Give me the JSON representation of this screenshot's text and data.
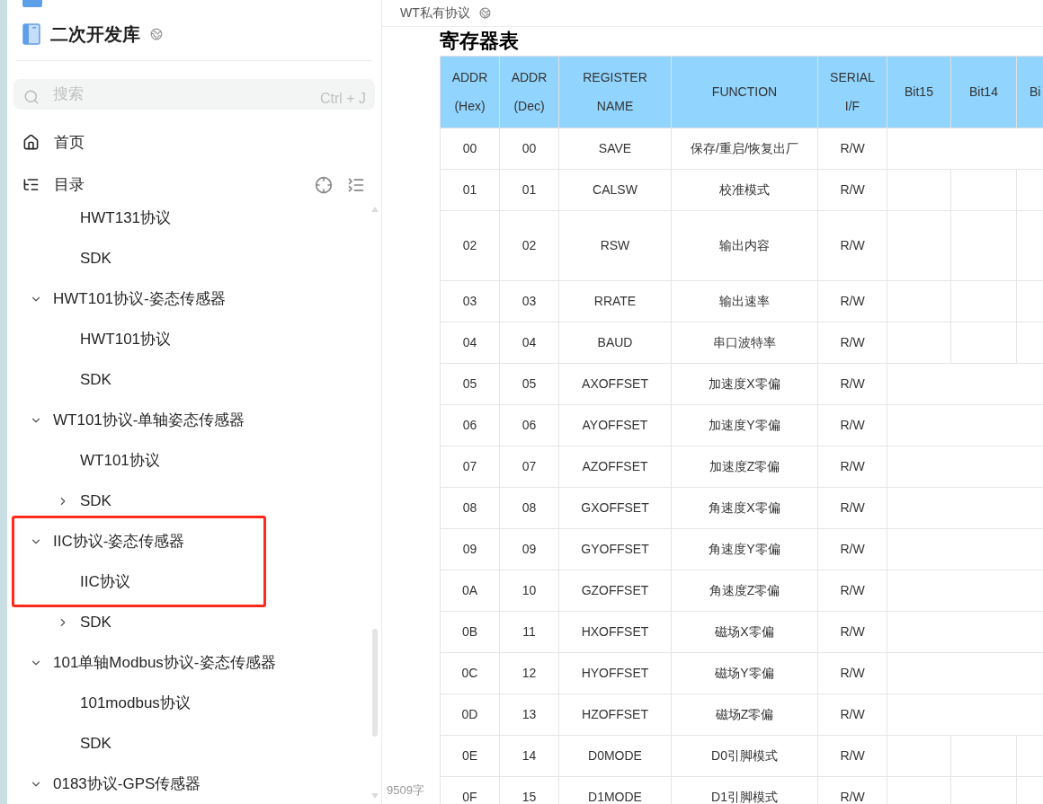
{
  "sidebar": {
    "title": "二次开发库",
    "search": {
      "placeholder": "搜索",
      "shortcut": "Ctrl + J"
    },
    "nav": [
      {
        "kind": "home",
        "label": "首页"
      },
      {
        "kind": "toc",
        "label": "目录"
      }
    ],
    "tree": [
      {
        "children": [
          {
            "label": "HWT131协议"
          },
          {
            "label": "SDK"
          }
        ]
      },
      {
        "label": "HWT101协议-姿态传感器",
        "expanded": true,
        "children": [
          {
            "label": "HWT101协议"
          },
          {
            "label": "SDK"
          }
        ]
      },
      {
        "label": "WT101协议-单轴姿态传感器",
        "expanded": true,
        "children": [
          {
            "label": "WT101协议"
          },
          {
            "label": "SDK",
            "expanded": false
          }
        ]
      },
      {
        "label": "IIC协议-姿态传感器",
        "expanded": true,
        "highlighted": true,
        "children": [
          {
            "label": "IIC协议",
            "highlighted": true
          },
          {
            "label": "SDK",
            "expanded": false
          }
        ]
      },
      {
        "label": "101单轴Modbus协议-姿态传感器",
        "expanded": true,
        "children": [
          {
            "label": "101modbus协议"
          },
          {
            "label": "SDK"
          }
        ]
      },
      {
        "label": "0183协议-GPS传感器",
        "expanded": true
      }
    ]
  },
  "main": {
    "breadcrumb": "WT私有协议",
    "heading": "寄存器表",
    "word_count": "9509字",
    "table": {
      "columns": [
        "ADDR (Hex)",
        "ADDR (Dec)",
        "REGISTER NAME",
        "FUNCTION",
        "SERIAL I/F",
        "Bit15",
        "Bit14",
        "Bi"
      ],
      "rows": [
        {
          "kind": "merged",
          "cells": [
            "00",
            "00",
            "SAVE",
            "保存/重启/恢复出厂",
            "R/W"
          ]
        },
        {
          "kind": "split",
          "cells": [
            "01",
            "01",
            "CALSW",
            "校准模式",
            "R/W"
          ]
        },
        {
          "kind": "split_tall",
          "cells": [
            "02",
            "02",
            "RSW",
            "输出内容",
            "R/W"
          ]
        },
        {
          "kind": "split",
          "cells": [
            "03",
            "03",
            "RRATE",
            "输出速率",
            "R/W"
          ]
        },
        {
          "kind": "split",
          "cells": [
            "04",
            "04",
            "BAUD",
            "串口波特率",
            "R/W"
          ]
        },
        {
          "kind": "merged",
          "cells": [
            "05",
            "05",
            "AXOFFSET",
            "加速度X零偏",
            "R/W"
          ]
        },
        {
          "kind": "merged",
          "cells": [
            "06",
            "06",
            "AYOFFSET",
            "加速度Y零偏",
            "R/W"
          ]
        },
        {
          "kind": "merged",
          "cells": [
            "07",
            "07",
            "AZOFFSET",
            "加速度Z零偏",
            "R/W"
          ]
        },
        {
          "kind": "merged",
          "cells": [
            "08",
            "08",
            "GXOFFSET",
            "角速度X零偏",
            "R/W"
          ]
        },
        {
          "kind": "merged",
          "cells": [
            "09",
            "09",
            "GYOFFSET",
            "角速度Y零偏",
            "R/W"
          ]
        },
        {
          "kind": "merged",
          "cells": [
            "0A",
            "10",
            "GZOFFSET",
            "角速度Z零偏",
            "R/W"
          ]
        },
        {
          "kind": "merged",
          "cells": [
            "0B",
            "11",
            "HXOFFSET",
            "磁场X零偏",
            "R/W"
          ]
        },
        {
          "kind": "merged",
          "cells": [
            "0C",
            "12",
            "HYOFFSET",
            "磁场Y零偏",
            "R/W"
          ]
        },
        {
          "kind": "merged",
          "cells": [
            "0D",
            "13",
            "HZOFFSET",
            "磁场Z零偏",
            "R/W"
          ]
        },
        {
          "kind": "split",
          "cells": [
            "0E",
            "14",
            "D0MODE",
            "D0引脚模式",
            "R/W"
          ]
        },
        {
          "kind": "split",
          "cells": [
            "0F",
            "15",
            "D1MODE",
            "D1引脚模式",
            "R/W"
          ]
        }
      ]
    }
  }
}
